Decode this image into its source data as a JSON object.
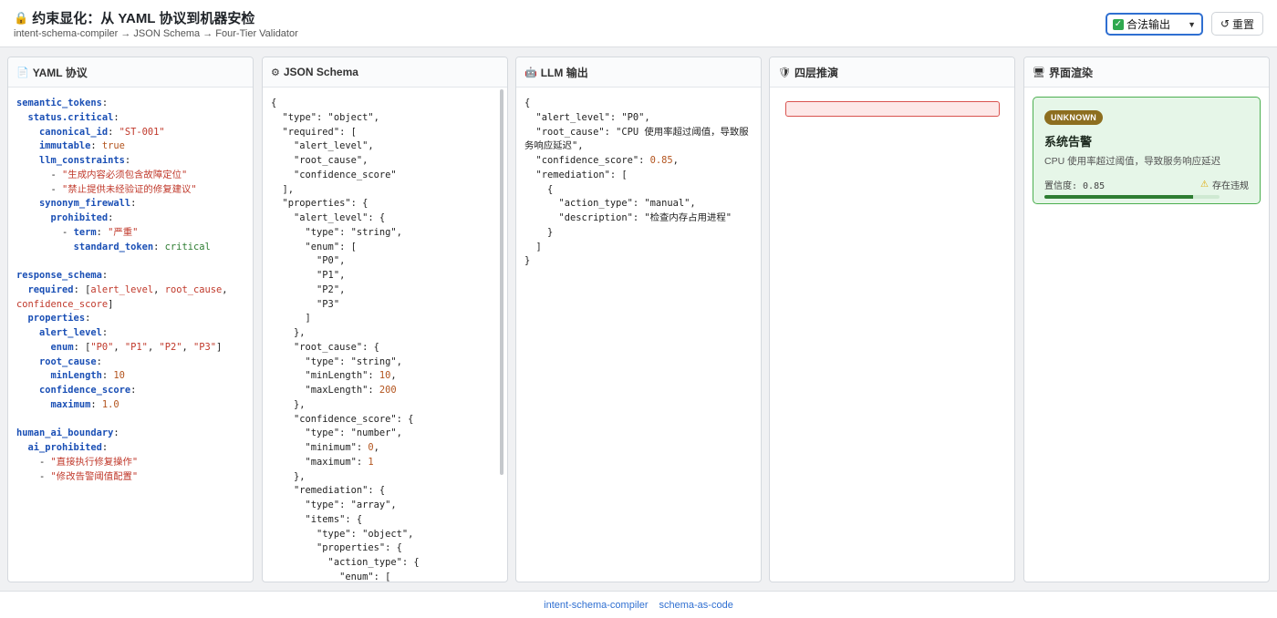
{
  "header": {
    "title": "约束显化：从 YAML 协议到机器安检",
    "subtitle": "intent-schema-compiler → JSON Schema → Four-Tier Validator",
    "title_icon": "lock-icon",
    "select_value": "合法输出",
    "reset_label": "重置"
  },
  "panels": {
    "yaml": {
      "label": "YAML 协议",
      "icon": "document-icon"
    },
    "schema": {
      "label": "JSON Schema",
      "icon": "gear-icon"
    },
    "llm": {
      "label": "LLM 输出",
      "icon": "robot-icon"
    },
    "deduce": {
      "label": "四层推演",
      "icon": "shield-icon"
    },
    "render": {
      "label": "界面渲染",
      "icon": "monitor-icon"
    }
  },
  "yaml_lines": [
    [
      [
        "k",
        "semantic_tokens"
      ],
      [
        "p",
        ":"
      ]
    ],
    [
      [
        "p",
        "  "
      ],
      [
        "k",
        "status.critical"
      ],
      [
        "p",
        ":"
      ]
    ],
    [
      [
        "p",
        "    "
      ],
      [
        "k",
        "canonical_id"
      ],
      [
        "p",
        ": "
      ],
      [
        "s",
        "\"ST-001\""
      ]
    ],
    [
      [
        "p",
        "    "
      ],
      [
        "k",
        "immutable"
      ],
      [
        "p",
        ": "
      ],
      [
        "n",
        "true"
      ]
    ],
    [
      [
        "p",
        "    "
      ],
      [
        "k",
        "llm_constraints"
      ],
      [
        "p",
        ":"
      ]
    ],
    [
      [
        "p",
        "      - "
      ],
      [
        "s",
        "\"生成内容必须包含故障定位\""
      ]
    ],
    [
      [
        "p",
        "      - "
      ],
      [
        "s",
        "\"禁止提供未经验证的修复建议\""
      ]
    ],
    [
      [
        "p",
        "    "
      ],
      [
        "k",
        "synonym_firewall"
      ],
      [
        "p",
        ":"
      ]
    ],
    [
      [
        "p",
        "      "
      ],
      [
        "k",
        "prohibited"
      ],
      [
        "p",
        ":"
      ]
    ],
    [
      [
        "p",
        "        - "
      ],
      [
        "k",
        "term"
      ],
      [
        "p",
        ": "
      ],
      [
        "s",
        "\"严重\""
      ]
    ],
    [
      [
        "p",
        "          "
      ],
      [
        "k",
        "standard_token"
      ],
      [
        "p",
        ": "
      ],
      [
        "b",
        "critical"
      ]
    ],
    [
      [
        "p",
        ""
      ]
    ],
    [
      [
        "k",
        "response_schema"
      ],
      [
        "p",
        ":"
      ]
    ],
    [
      [
        "p",
        "  "
      ],
      [
        "k",
        "required"
      ],
      [
        "p",
        ": ["
      ],
      [
        "s",
        "alert_level"
      ],
      [
        "p",
        ", "
      ],
      [
        "s",
        "root_cause"
      ],
      [
        "p",
        ","
      ]
    ],
    [
      [
        "s",
        "confidence_score"
      ],
      [
        "p",
        "]"
      ]
    ],
    [
      [
        "p",
        "  "
      ],
      [
        "k",
        "properties"
      ],
      [
        "p",
        ":"
      ]
    ],
    [
      [
        "p",
        "    "
      ],
      [
        "k",
        "alert_level"
      ],
      [
        "p",
        ":"
      ]
    ],
    [
      [
        "p",
        "      "
      ],
      [
        "k",
        "enum"
      ],
      [
        "p",
        ": ["
      ],
      [
        "s",
        "\"P0\""
      ],
      [
        "p",
        ", "
      ],
      [
        "s",
        "\"P1\""
      ],
      [
        "p",
        ", "
      ],
      [
        "s",
        "\"P2\""
      ],
      [
        "p",
        ", "
      ],
      [
        "s",
        "\"P3\""
      ],
      [
        "p",
        "]"
      ]
    ],
    [
      [
        "p",
        "    "
      ],
      [
        "k",
        "root_cause"
      ],
      [
        "p",
        ":"
      ]
    ],
    [
      [
        "p",
        "      "
      ],
      [
        "k",
        "minLength"
      ],
      [
        "p",
        ": "
      ],
      [
        "n",
        "10"
      ]
    ],
    [
      [
        "p",
        "    "
      ],
      [
        "k",
        "confidence_score"
      ],
      [
        "p",
        ":"
      ]
    ],
    [
      [
        "p",
        "      "
      ],
      [
        "k",
        "maximum"
      ],
      [
        "p",
        ": "
      ],
      [
        "n",
        "1.0"
      ]
    ],
    [
      [
        "p",
        ""
      ]
    ],
    [
      [
        "k",
        "human_ai_boundary"
      ],
      [
        "p",
        ":"
      ]
    ],
    [
      [
        "p",
        "  "
      ],
      [
        "k",
        "ai_prohibited"
      ],
      [
        "p",
        ":"
      ]
    ],
    [
      [
        "p",
        "    - "
      ],
      [
        "s",
        "\"直接执行修复操作\""
      ]
    ],
    [
      [
        "p",
        "    - "
      ],
      [
        "s",
        "\"修改告警阈值配置\""
      ]
    ]
  ],
  "schema_lines": [
    [
      [
        "p",
        "{"
      ]
    ],
    [
      [
        "p",
        "  \"type\": \"object\","
      ]
    ],
    [
      [
        "p",
        "  \"required\": ["
      ]
    ],
    [
      [
        "p",
        "    \"alert_level\","
      ]
    ],
    [
      [
        "p",
        "    \"root_cause\","
      ]
    ],
    [
      [
        "p",
        "    \"confidence_score\""
      ]
    ],
    [
      [
        "p",
        "  ],"
      ]
    ],
    [
      [
        "p",
        "  \"properties\": {"
      ]
    ],
    [
      [
        "p",
        "    \"alert_level\": {"
      ]
    ],
    [
      [
        "p",
        "      \"type\": \"string\","
      ]
    ],
    [
      [
        "p",
        "      \"enum\": ["
      ]
    ],
    [
      [
        "p",
        "        \"P0\","
      ]
    ],
    [
      [
        "p",
        "        \"P1\","
      ]
    ],
    [
      [
        "p",
        "        \"P2\","
      ]
    ],
    [
      [
        "p",
        "        \"P3\""
      ]
    ],
    [
      [
        "p",
        "      ]"
      ]
    ],
    [
      [
        "p",
        "    },"
      ]
    ],
    [
      [
        "p",
        "    \"root_cause\": {"
      ]
    ],
    [
      [
        "p",
        "      \"type\": \"string\","
      ]
    ],
    [
      [
        "p",
        "      \"minLength\": "
      ],
      [
        "n",
        "10"
      ],
      [
        "p",
        ","
      ]
    ],
    [
      [
        "p",
        "      \"maxLength\": "
      ],
      [
        "n",
        "200"
      ]
    ],
    [
      [
        "p",
        "    },"
      ]
    ],
    [
      [
        "p",
        "    \"confidence_score\": {"
      ]
    ],
    [
      [
        "p",
        "      \"type\": \"number\","
      ]
    ],
    [
      [
        "p",
        "      \"minimum\": "
      ],
      [
        "n",
        "0"
      ],
      [
        "p",
        ","
      ]
    ],
    [
      [
        "p",
        "      \"maximum\": "
      ],
      [
        "n",
        "1"
      ]
    ],
    [
      [
        "p",
        "    },"
      ]
    ],
    [
      [
        "p",
        "    \"remediation\": {"
      ]
    ],
    [
      [
        "p",
        "      \"type\": \"array\","
      ]
    ],
    [
      [
        "p",
        "      \"items\": {"
      ]
    ],
    [
      [
        "p",
        "        \"type\": \"object\","
      ]
    ],
    [
      [
        "p",
        "        \"properties\": {"
      ]
    ],
    [
      [
        "p",
        "          \"action_type\": {"
      ]
    ],
    [
      [
        "p",
        "            \"enum\": ["
      ]
    ]
  ],
  "llm_lines": [
    [
      [
        "p",
        "{"
      ]
    ],
    [
      [
        "p",
        "  \"alert_level\": \"P0\","
      ]
    ],
    [
      [
        "p",
        "  \"root_cause\": \"CPU 使用率超过阈值，导致服"
      ]
    ],
    [
      [
        "p",
        "务响应延迟\","
      ]
    ],
    [
      [
        "p",
        "  \"confidence_score\": "
      ],
      [
        "n",
        "0.85"
      ],
      [
        "p",
        ","
      ]
    ],
    [
      [
        "p",
        "  \"remediation\": ["
      ]
    ],
    [
      [
        "p",
        "    {"
      ]
    ],
    [
      [
        "p",
        "      \"action_type\": \"manual\","
      ]
    ],
    [
      [
        "p",
        "      \"description\": \"检查内存占用进程\""
      ]
    ],
    [
      [
        "p",
        "    }"
      ]
    ],
    [
      [
        "p",
        "  ]"
      ]
    ],
    [
      [
        "p",
        "}"
      ]
    ]
  ],
  "render_card": {
    "badge": "UNKNOWN",
    "title": "系统告警",
    "description": "CPU 使用率超过阈值，导致服务响应延迟",
    "confidence_text": "置信度: 0.85",
    "warning_text": "存在违规",
    "confidence": 0.85
  },
  "footer": {
    "links": [
      "intent-schema-compiler",
      "schema-as-code"
    ]
  }
}
